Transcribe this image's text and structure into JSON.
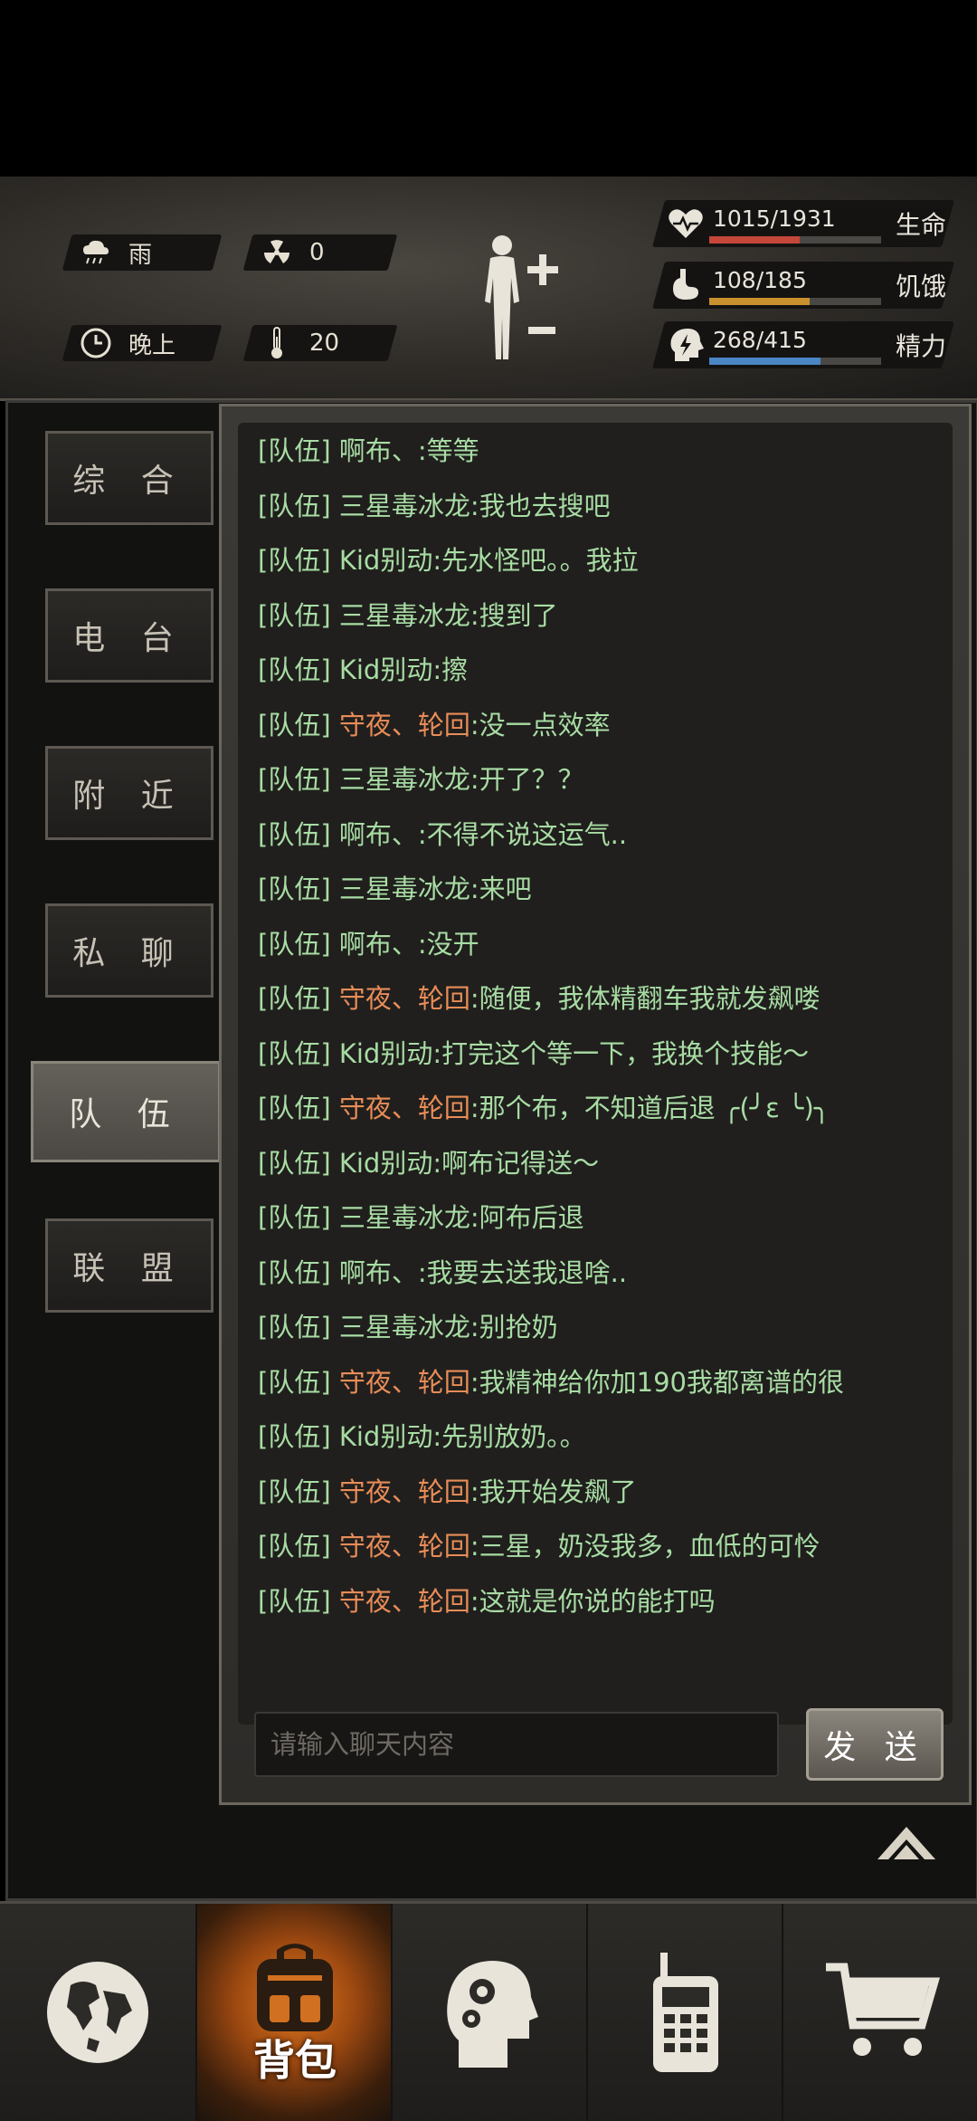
{
  "status": {
    "weather": "雨",
    "radiation": "0",
    "time_of_day": "晚上",
    "temperature": "20",
    "stats": [
      {
        "value": "1015/1931",
        "label": "生命",
        "fraction": 0.526,
        "color": "#c4473a"
      },
      {
        "value": "108/185",
        "label": "饥饿",
        "fraction": 0.584,
        "color": "#c9912e"
      },
      {
        "value": "268/415",
        "label": "精力",
        "fraction": 0.646,
        "color": "#4a86c4"
      }
    ]
  },
  "tabs": [
    "综 合",
    "电 台",
    "附 近",
    "私 聊",
    "队 伍",
    "联 盟"
  ],
  "active_tab": "队 伍",
  "messages": [
    {
      "channel": "[队伍]",
      "name": "啊布、",
      "text": ":等等",
      "orange": false
    },
    {
      "channel": "[队伍]",
      "name": "三星毒冰龙",
      "text": ":我也去搜吧",
      "orange": false
    },
    {
      "channel": "[队伍]",
      "name": "Kid别动",
      "text": ":先水怪吧。。我拉",
      "orange": false
    },
    {
      "channel": "[队伍]",
      "name": "三星毒冰龙",
      "text": ":搜到了",
      "orange": false
    },
    {
      "channel": "[队伍]",
      "name": "Kid别动",
      "text": ":擦",
      "orange": false
    },
    {
      "channel": "[队伍]",
      "name": "守夜、轮回",
      "text": ":没一点效率",
      "orange": true
    },
    {
      "channel": "[队伍]",
      "name": "三星毒冰龙",
      "text": ":开了？？",
      "orange": false
    },
    {
      "channel": "[队伍]",
      "name": "啊布、",
      "text": ":不得不说这运气..",
      "orange": false
    },
    {
      "channel": "[队伍]",
      "name": "三星毒冰龙",
      "text": ":来吧",
      "orange": false
    },
    {
      "channel": "[队伍]",
      "name": "啊布、",
      "text": ":没开",
      "orange": false
    },
    {
      "channel": "[队伍]",
      "name": "守夜、轮回",
      "text": ":随便，我体精翻车我就发飙喽",
      "orange": true
    },
    {
      "channel": "[队伍]",
      "name": "Kid别动",
      "text": ":打完这个等一下，我换个技能～",
      "orange": false
    },
    {
      "channel": "[队伍]",
      "name": "守夜、轮回",
      "text": ":那个布，不知道后退 ╭(╯ε ╰)╮",
      "orange": true
    },
    {
      "channel": "[队伍]",
      "name": "Kid别动",
      "text": ":啊布记得送～",
      "orange": false
    },
    {
      "channel": "[队伍]",
      "name": "三星毒冰龙",
      "text": ":阿布后退",
      "orange": false
    },
    {
      "channel": "[队伍]",
      "name": "啊布、",
      "text": ":我要去送我退啥..",
      "orange": false
    },
    {
      "channel": "[队伍]",
      "name": "三星毒冰龙",
      "text": ":别抢奶",
      "orange": false
    },
    {
      "channel": "[队伍]",
      "name": "守夜、轮回",
      "text": ":我精神给你加190我都离谱的很",
      "orange": true
    },
    {
      "channel": "[队伍]",
      "name": "Kid别动",
      "text": ":先别放奶。。",
      "orange": false
    },
    {
      "channel": "[队伍]",
      "name": "守夜、轮回",
      "text": ":我开始发飙了",
      "orange": true
    },
    {
      "channel": "[队伍]",
      "name": "守夜、轮回",
      "text": ":三星，奶没我多，血低的可怜",
      "orange": true
    },
    {
      "channel": "[队伍]",
      "name": "守夜、轮回",
      "text": ":这就是你说的能打吗",
      "orange": true
    }
  ],
  "input": {
    "placeholder": "请输入聊天内容"
  },
  "send_label": "发 送",
  "nav": {
    "active_label": "背包"
  }
}
